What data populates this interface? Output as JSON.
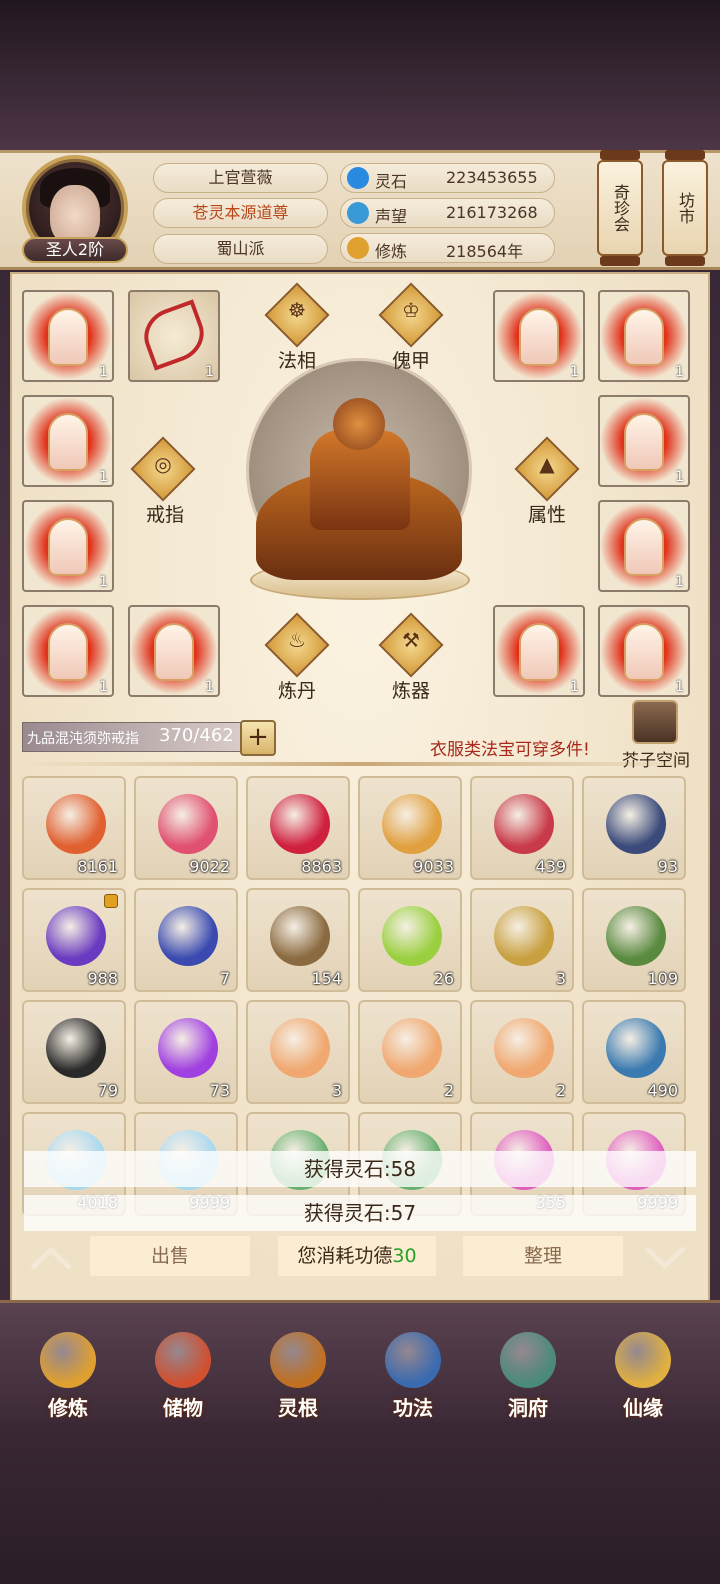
{
  "player": {
    "rank": "圣人2阶",
    "name": "上官萱薇",
    "title": "苍灵本源道尊",
    "sect": "蜀山派"
  },
  "stats": [
    {
      "icon": "spirit-stone-icon",
      "label": "灵石",
      "value": "223453655",
      "color": "#2a8ae0"
    },
    {
      "icon": "prestige-icon",
      "label": "声望",
      "value": "216173268",
      "color": "#3a9ad8"
    },
    {
      "icon": "cultivation-icon",
      "label": "修炼",
      "value": "218564年",
      "color": "#e0a030"
    }
  ],
  "side_buttons": {
    "treasure_hall": "奇珍会",
    "market": "坊市"
  },
  "equipment": {
    "slots_left": [
      {
        "count": "1"
      },
      {
        "count": "1"
      },
      {
        "count": "1"
      },
      {
        "count": "1"
      },
      {
        "count": "1"
      }
    ],
    "slots_right": [
      {
        "count": "1"
      },
      {
        "count": "1"
      },
      {
        "count": "1"
      },
      {
        "count": "1"
      },
      {
        "count": "1"
      },
      {
        "count": "1"
      }
    ],
    "bow_count": "1",
    "bottom_left_count": "1",
    "buttons": {
      "fa_xiang": "法相",
      "kui_jia": "傀甲",
      "jie_zhi": "戒指",
      "shu_xing": "属性",
      "lian_dan": "炼丹",
      "lian_qi": "炼器"
    }
  },
  "storage": {
    "ring_name": "九品混沌须弥戒指",
    "capacity": "370/462",
    "plus": "+",
    "hint": "衣服类法宝可穿多件!",
    "space_label": "芥子空间"
  },
  "inventory": [
    {
      "icon": "peach-icon",
      "count": "8161",
      "color": "#e06030"
    },
    {
      "icon": "berries-icon",
      "count": "9022",
      "color": "#e05070"
    },
    {
      "icon": "raspberry-icon",
      "count": "8863",
      "color": "#d02040"
    },
    {
      "icon": "lotus-fruit-icon",
      "count": "9033",
      "color": "#e0a040"
    },
    {
      "icon": "pomegranate-icon",
      "count": "439",
      "color": "#c83a4a"
    },
    {
      "icon": "taiji-compass-icon",
      "count": "93",
      "color": "#3a4a7a"
    },
    {
      "icon": "purple-crystal-icon",
      "count": "988",
      "color": "#6a3ac0",
      "locked": true
    },
    {
      "icon": "blue-herb-icon",
      "count": "7",
      "color": "#3a4ab0"
    },
    {
      "icon": "bound-sticks-icon",
      "count": "154",
      "color": "#8a6a40"
    },
    {
      "icon": "green-fruit-icon",
      "count": "26",
      "color": "#9ad040"
    },
    {
      "icon": "talisman-gold-icon",
      "count": "3",
      "color": "#c8a040"
    },
    {
      "icon": "talisman-green-icon",
      "count": "109",
      "color": "#5a8a40"
    },
    {
      "icon": "black-talisman-icon",
      "count": "79",
      "color": "#2a2a2a"
    },
    {
      "icon": "purple-flame-icon",
      "count": "73",
      "color": "#a040e0"
    },
    {
      "icon": "scroll-icon",
      "count": "3",
      "color": "#f0a870"
    },
    {
      "icon": "scroll-icon",
      "count": "2",
      "color": "#f0a870"
    },
    {
      "icon": "scroll-icon",
      "count": "2",
      "color": "#f0a870"
    },
    {
      "icon": "dragon-icon",
      "count": "490",
      "color": "#3a7ab0"
    },
    {
      "icon": "white-flower-icon",
      "count": "4018",
      "color": "#a8d8f0"
    },
    {
      "icon": "white-flower-icon",
      "count": "9999",
      "color": "#a8d8f0"
    },
    {
      "icon": "green-feather-icon",
      "count": "",
      "color": "#6ab070"
    },
    {
      "icon": "green-feather-icon",
      "count": "",
      "color": "#6ab070"
    },
    {
      "icon": "pink-flower-icon",
      "count": "355",
      "color": "#e060c0"
    },
    {
      "icon": "pink-flower-icon",
      "count": "9999",
      "color": "#e060c0"
    }
  ],
  "toasts": [
    "获得灵石:58",
    "获得灵石:57"
  ],
  "actions": {
    "sell": "出售",
    "merit_prefix": "您消耗功德",
    "merit_value": "30",
    "sort": "整理"
  },
  "nav": [
    {
      "icon": "cultivate-icon",
      "label": "修炼",
      "color": "#e0a030"
    },
    {
      "icon": "storage-bag-icon",
      "label": "储物",
      "color": "#d05030"
    },
    {
      "icon": "spirit-root-icon",
      "label": "灵根",
      "color": "#c07020"
    },
    {
      "icon": "technique-book-icon",
      "label": "功法",
      "color": "#3a6ab0"
    },
    {
      "icon": "cave-icon",
      "label": "洞府",
      "color": "#4a8a7a"
    },
    {
      "icon": "fortune-gourd-icon",
      "label": "仙缘",
      "color": "#e0b040"
    }
  ]
}
